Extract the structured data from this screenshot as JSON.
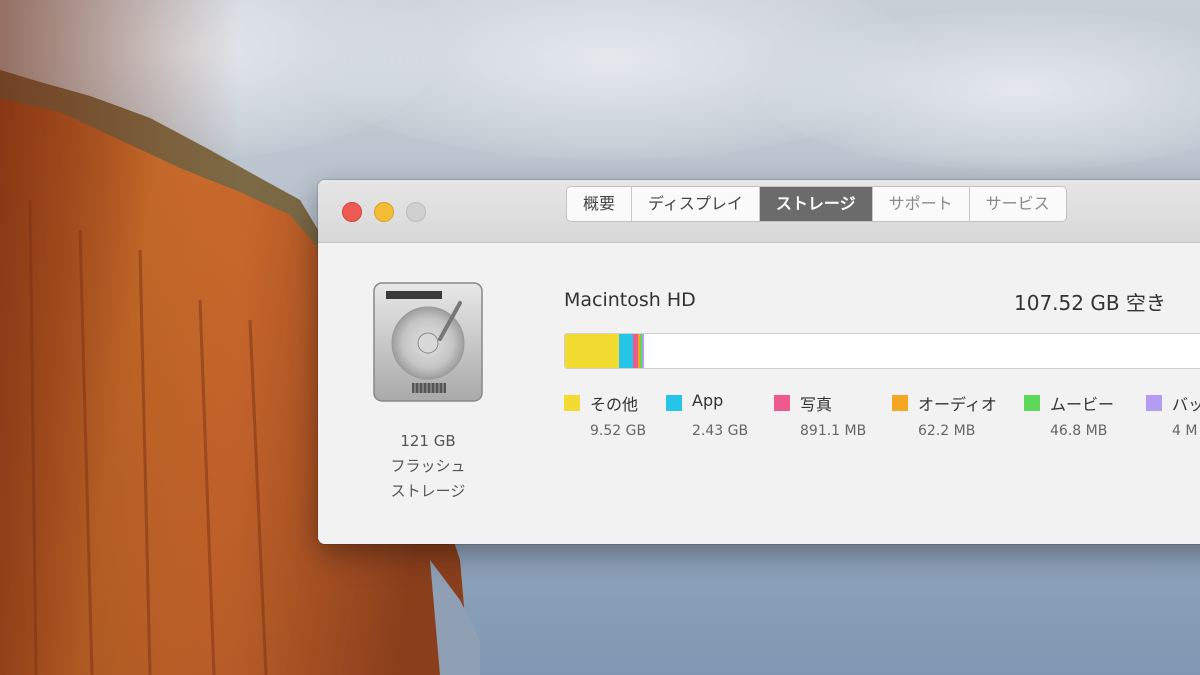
{
  "window": {
    "tabs": [
      {
        "label": "概要",
        "active": false
      },
      {
        "label": "ディスプレイ",
        "active": false
      },
      {
        "label": "ストレージ",
        "active": true
      },
      {
        "label": "サポート",
        "active": false
      },
      {
        "label": "サービス",
        "active": false
      }
    ]
  },
  "disk": {
    "capacity": "121 GB",
    "type_line1": "フラッシュ",
    "type_line2": "ストレージ",
    "icon": "hard-drive-icon"
  },
  "volume": {
    "name": "Macintosh HD",
    "free": "107.52 GB 空き",
    "categories": [
      {
        "label": "その他",
        "size": "9.52 GB",
        "color": "#f2dc32",
        "fraction": 0.0787
      },
      {
        "label": "App",
        "size": "2.43 GB",
        "color": "#27c4ea",
        "fraction": 0.0201
      },
      {
        "label": "写真",
        "size": "891.1 MB",
        "color": "#ef5a8e",
        "fraction": 0.0074
      },
      {
        "label": "オーディオ",
        "size": "62.2 MB",
        "color": "#f5a623",
        "fraction": 0.0005
      },
      {
        "label": "ムービー",
        "size": "46.8 MB",
        "color": "#5dd85a",
        "fraction": 0.0004
      },
      {
        "label": "バッ",
        "size": "4 M",
        "color": "#b49cf2",
        "fraction": 0.0001
      }
    ]
  }
}
